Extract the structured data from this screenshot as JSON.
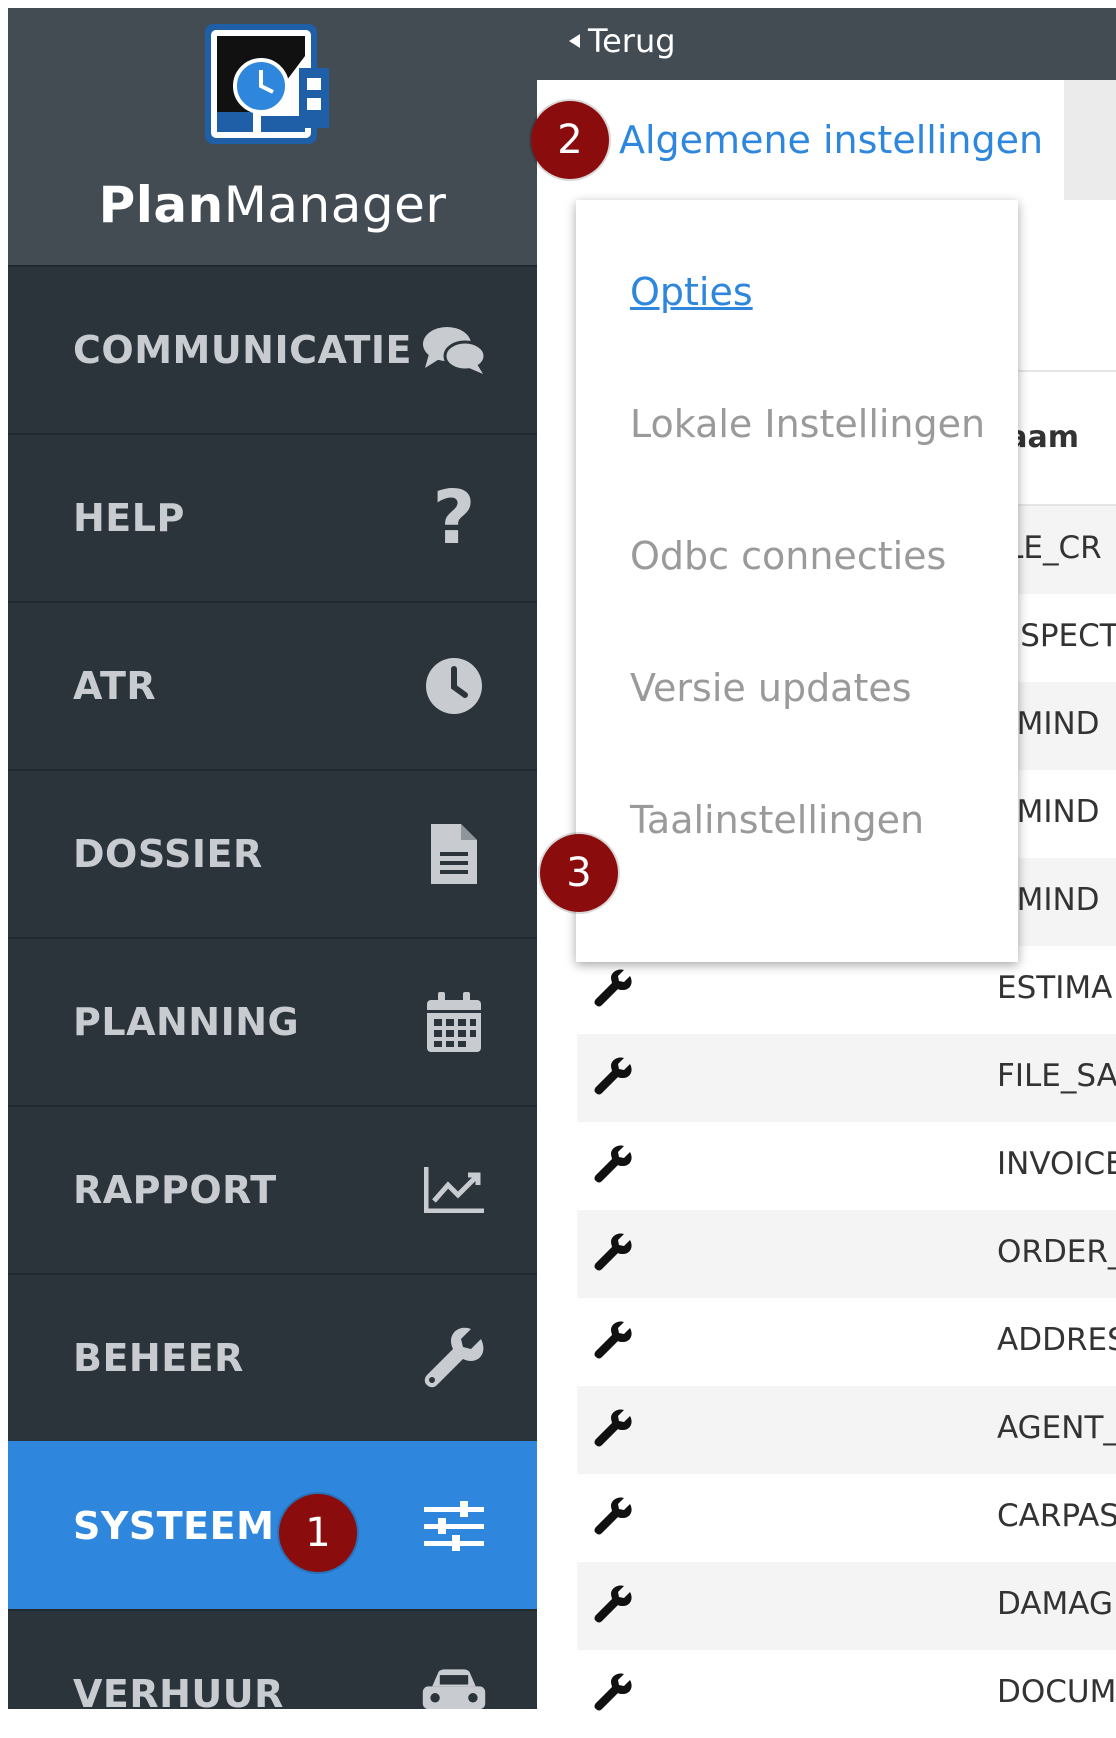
{
  "app": {
    "name_bold": "Plan",
    "name_regular": "Manager"
  },
  "topbar": {
    "back_label": "Terug"
  },
  "tab": {
    "label": "Algemene instellingen"
  },
  "sidebar": {
    "items": [
      {
        "label": "COMMUNICATIE",
        "icon": "comments-icon"
      },
      {
        "label": "HELP",
        "icon": "question-icon"
      },
      {
        "label": "ATR",
        "icon": "clock-icon"
      },
      {
        "label": "DOSSIER",
        "icon": "document-icon"
      },
      {
        "label": "PLANNING",
        "icon": "calendar-icon"
      },
      {
        "label": "RAPPORT",
        "icon": "chart-icon"
      },
      {
        "label": "BEHEER",
        "icon": "wrench-icon"
      },
      {
        "label": "SYSTEEM",
        "icon": "sliders-icon",
        "active": true
      },
      {
        "label": "VERHUUR",
        "icon": "car-icon"
      }
    ]
  },
  "dropdown": {
    "items": [
      "Opties",
      "Lokale Instellingen",
      "Odbc connecties",
      "Versie updates",
      "Taalinstellingen"
    ]
  },
  "table": {
    "header": "laam",
    "rows": [
      "ILE_CR",
      "NSPECT",
      "EMIND",
      "EMIND",
      "EMIND",
      "ESTIMA",
      "FILE_SA",
      "INVOICE",
      "ORDER_",
      "ADDRES",
      "AGENT_",
      "CARPAS",
      "DAMAG",
      "DOCUM"
    ]
  },
  "badges": [
    "1",
    "2",
    "3"
  ],
  "colors": {
    "accent": "#2e87dc",
    "sidebar": "#2b333b",
    "badge": "#8b0c0c"
  }
}
